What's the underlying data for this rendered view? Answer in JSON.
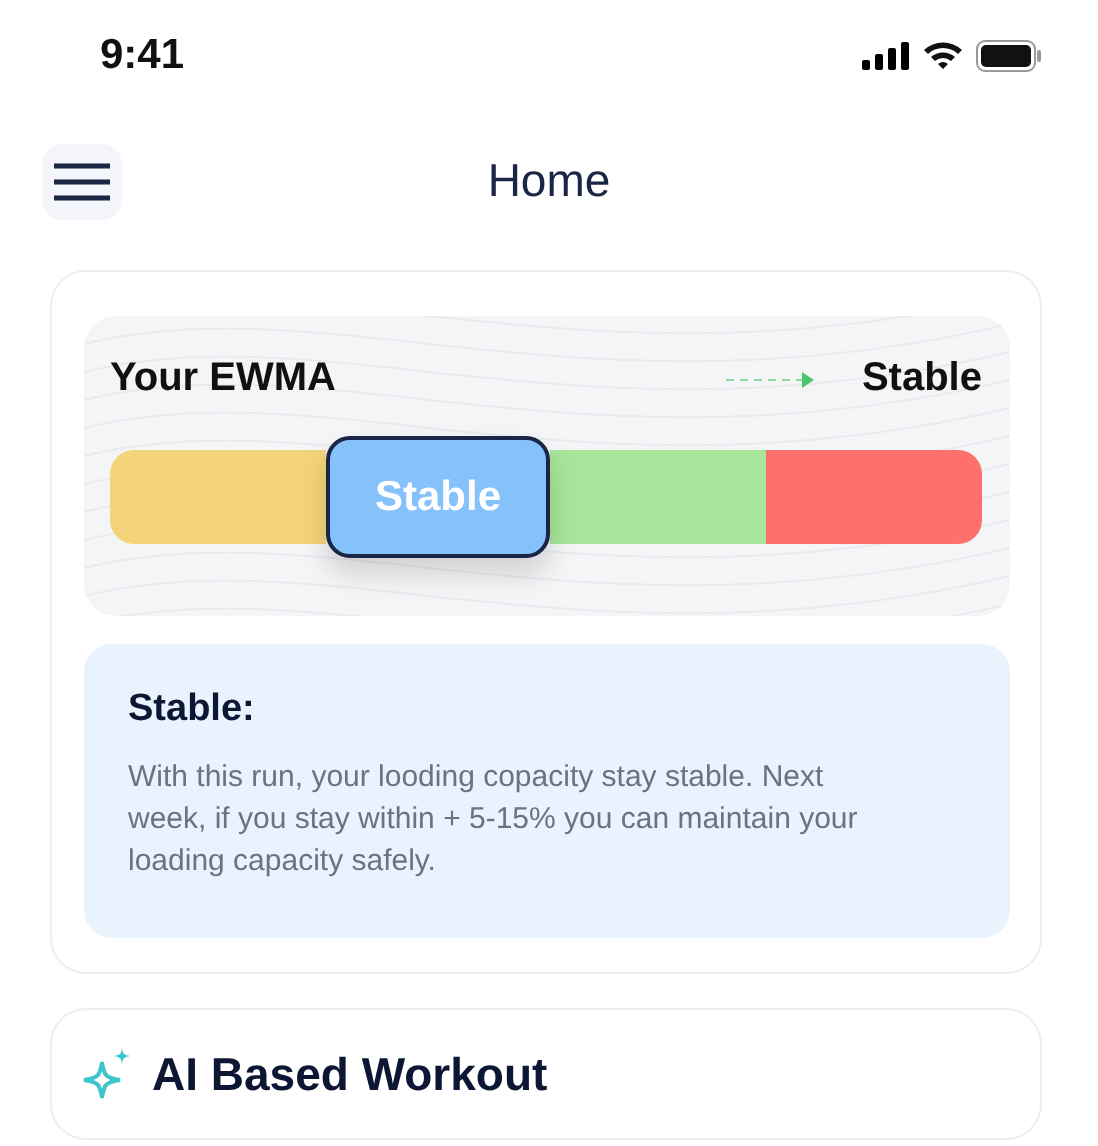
{
  "status_bar": {
    "time": "9:41"
  },
  "header": {
    "title": "Home"
  },
  "ewma": {
    "label": "Your EWMA",
    "trend": "Stable",
    "segments": [
      {
        "color": "#f4d47a",
        "selected": false
      },
      {
        "color": "#85c1fb",
        "selected": true,
        "label": "Stable"
      },
      {
        "color": "#a8e49a",
        "selected": false
      },
      {
        "color": "#ff706c",
        "selected": false
      }
    ]
  },
  "info": {
    "title": "Stable:",
    "text": "With this run, your looding copacity stay stable. Next week, if you stay within + 5-15% you can maintain your loading capacity safely."
  },
  "workout": {
    "title": "AI Based Workout"
  }
}
